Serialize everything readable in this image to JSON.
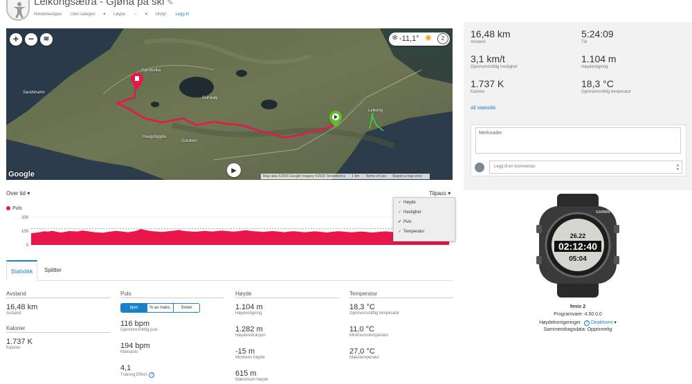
{
  "header": {
    "title": "Leikongsætra - Gjøna på ski",
    "meta": {
      "event_type_label": "Hendelsestype:",
      "event_type_value": "Uten kategori",
      "course_label": "Løype:",
      "course_value": "--",
      "gear_label": "Utstyr:",
      "gear_link": "Legg til"
    }
  },
  "map": {
    "temperature": "-11,1°",
    "wind": "2",
    "places": [
      "Sandshamn",
      "Gjerdsvika",
      "Gurskøy",
      "Leikong",
      "Haugsbygda",
      "Gursken"
    ],
    "logo": "Google",
    "attribution": [
      "Map data ©2016 Google Imagery ©2016 TerraMetrics",
      "1 km",
      "Terms of Use",
      "Report a map error"
    ]
  },
  "chart_header": {
    "left": "Over tid",
    "right": "Tilpass"
  },
  "chart_data": {
    "type": "area",
    "series": [
      {
        "name": "Puls",
        "color": "#e8174a",
        "values": [
          84,
          88,
          92,
          98,
          96,
          102,
          95,
          90,
          94,
          100,
          99,
          97,
          104,
          101,
          96,
          92,
          90,
          88,
          93,
          97,
          101,
          99,
          95,
          92,
          96,
          103,
          115,
          108,
          102,
          98,
          96,
          94,
          97,
          100,
          104,
          108,
          102,
          99,
          97,
          95,
          98,
          101,
          99,
          97,
          100,
          104,
          102,
          98,
          96,
          99,
          103,
          106,
          101,
          98,
          96,
          94,
          97,
          100,
          98,
          95,
          92,
          96,
          99,
          97,
          94,
          92,
          95,
          98,
          96,
          93,
          90,
          94,
          97,
          99,
          96,
          93,
          91,
          94,
          97,
          95,
          92,
          90,
          93,
          96,
          98,
          95,
          92,
          90,
          88,
          91,
          94,
          92,
          90,
          88,
          86,
          90,
          93,
          96,
          98,
          100
        ]
      }
    ],
    "ylim": [
      0,
      200
    ],
    "yticks": [
      0,
      100,
      200
    ],
    "reference_line": 116
  },
  "chart_menu": [
    {
      "label": "Høyde",
      "checked": false
    },
    {
      "label": "Hastighet",
      "checked": false
    },
    {
      "label": "Puls",
      "checked": true
    },
    {
      "label": "Temperatur",
      "checked": false
    }
  ],
  "tabs": [
    "Statistikk",
    "Splitter"
  ],
  "stats": {
    "col1": {
      "header1": "Avstand",
      "distance": {
        "value": "16,48 km",
        "label": "Avstand"
      },
      "header2": "Kalorier",
      "calories": {
        "value": "1.737 K",
        "label": "Kalorier"
      }
    },
    "col2": {
      "header": "Puls",
      "segments": [
        "bpm",
        "% av maks.",
        "Soner"
      ],
      "avg": {
        "value": "116 bpm",
        "label": "Gjennomsnittlig puls"
      },
      "max": {
        "value": "194 bpm",
        "label": "Makspuls"
      },
      "te": {
        "value": "4,1",
        "label": "Training Effect"
      }
    },
    "col3": {
      "header": "Høyde",
      "gain": {
        "value": "1.104 m",
        "label": "Høydestigning"
      },
      "loss": {
        "value": "1.282 m",
        "label": "Høydereduksjon"
      },
      "min": {
        "value": "-15 m",
        "label": "Minimum høyde"
      },
      "max": {
        "value": "615 m",
        "label": "Maksimum høyde"
      }
    },
    "col4": {
      "header": "Temperatur",
      "avg": {
        "value": "18,3 °C",
        "label": "Gjennomsnittlig temperatur"
      },
      "min": {
        "value": "11,0 °C",
        "label": "Minimumstemperatur"
      },
      "max": {
        "value": "27,0 °C",
        "label": "Makstemperatur"
      }
    }
  },
  "summary": {
    "distance": {
      "value": "16,48 km",
      "label": "Avstand"
    },
    "time": {
      "value": "5:24:09",
      "label": "Tid"
    },
    "speed": {
      "value": "3,1 km/t",
      "label": "Gjennomsnittlig hastighet"
    },
    "ascent": {
      "value": "1.104 m",
      "label": "Høydestigning"
    },
    "calories": {
      "value": "1.737 K",
      "label": "Kalorier"
    },
    "temp": {
      "value": "18,3 °C",
      "label": "Gjennomsnittlig temperatur"
    },
    "all_stats_link": "All statistikk"
  },
  "notes": {
    "placeholder": "Merknader",
    "comment_placeholder": "Legg til en kommentar."
  },
  "device": {
    "brand": "GARMIN",
    "screen": {
      "line1": "26.22",
      "line2": "02:12:40",
      "line3": "05:04"
    },
    "name": "fenix 2",
    "firmware_label": "Programvare:",
    "firmware": "4.50.0.0",
    "elev_label": "Høydekorrigeringer",
    "elev_value": "Deaktivert",
    "summary_label": "Sammendragsdata:",
    "summary_value": "Opprinnelig"
  }
}
